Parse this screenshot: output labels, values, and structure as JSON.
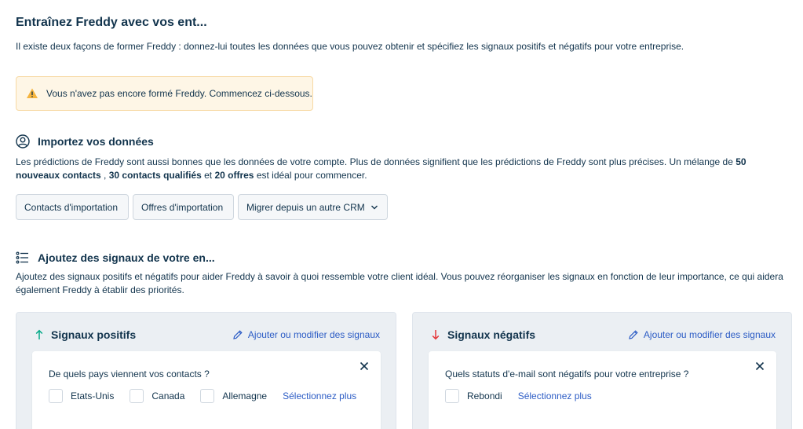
{
  "page": {
    "title": "Entraînez Freddy avec vos ent...",
    "intro": "Il existe deux façons de former Freddy : donnez-lui toutes les données que vous pouvez obtenir et spécifiez les signaux positifs et négatifs pour votre entreprise."
  },
  "warning": {
    "text": "Vous n'avez pas encore formé Freddy. Commencez ci-dessous.",
    "icon": "warning-triangle-icon",
    "color": "#f5b43f"
  },
  "import_section": {
    "title": "Importez vos données",
    "icon": "user-circle-icon",
    "desc_part1": "Les prédictions de Freddy sont aussi bonnes que les données de votre compte. Plus de données signifient que les prédictions de Freddy sont plus précises. Un mélange de ",
    "desc_bold1": "50 nouveaux contacts",
    "desc_part2": " , ",
    "desc_bold2": "30 contacts qualifiés",
    "desc_part3": " et ",
    "desc_bold3": "20 offres",
    "desc_part4": " est idéal pour commencer.",
    "buttons": {
      "import_contacts": "Contacts d'importation",
      "import_deals": "Offres d'importation",
      "migrate_crm": "Migrer depuis un autre CRM"
    }
  },
  "signals_section": {
    "title": "Ajoutez des signaux de votre en...",
    "icon": "list-icon",
    "desc": "Ajoutez des signaux positifs et négatifs pour aider Freddy à savoir à quoi ressemble votre client idéal. Vous pouvez réorganiser les signaux en fonction de leur importance, ce qui aidera également Freddy à établir des priorités."
  },
  "positive_panel": {
    "title": "Signaux positifs",
    "arrow_color": "#00a886",
    "link": "Ajouter ou modifier des signaux",
    "card": {
      "question": "De quels pays viennent vos contacts ?",
      "options": [
        "Etats-Unis",
        "Canada",
        "Allemagne"
      ],
      "more": "Sélectionnez plus"
    }
  },
  "negative_panel": {
    "title": "Signaux négatifs",
    "arrow_color": "#e43538",
    "link": "Ajouter ou modifier des signaux",
    "card": {
      "question": "Quels statuts d'e-mail sont négatifs pour votre entreprise ?",
      "options": [
        "Rebondi"
      ],
      "more": "Sélectionnez plus"
    }
  },
  "colors": {
    "text": "#12344d",
    "link": "#2c5cc5",
    "warning_bg": "#fef6e6",
    "panel_bg": "#ebeff3"
  }
}
